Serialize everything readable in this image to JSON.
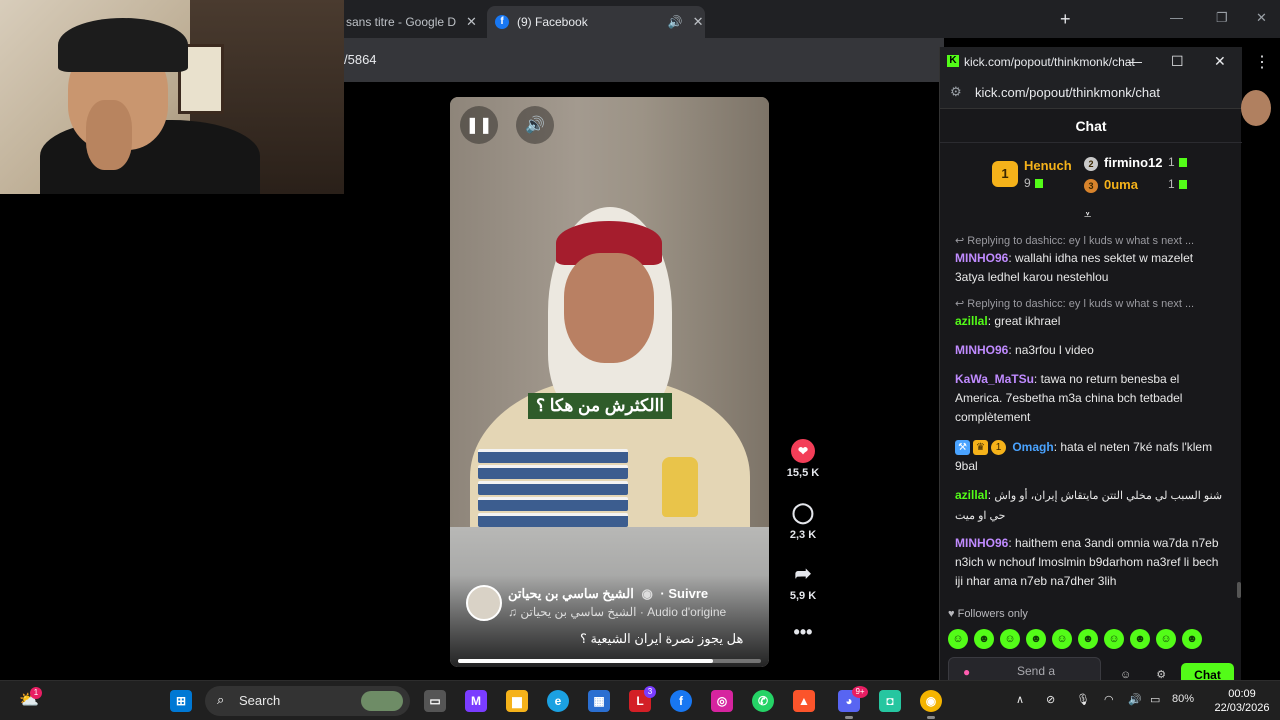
{
  "browser": {
    "tabs": [
      {
        "title": "sans titre - Google D",
        "close": "✕"
      },
      {
        "title": "(9) Facebook",
        "close": "✕"
      }
    ],
    "new_tab": "+",
    "address_fragment": "/5864",
    "menu": "⋮"
  },
  "reel": {
    "subtitle": "االكثرش من هكا ؟",
    "author": "الشيخ ساسي بن يحياتن",
    "follow": "· Suivre",
    "audio_author": "الشيخ ساسي بن يحياتن",
    "audio_label": "· Audio d'origine",
    "caption": "هل يجوز نصرة ايران الشيعية ؟",
    "progress": 0.84,
    "likes": "15,5 K",
    "comments": "2,3 K",
    "shares": "5,9 K"
  },
  "kick": {
    "window_title": "kick.com/popout/thinkmonk/chat",
    "url": "kick.com/popout/thinkmonk/chat",
    "chat_title": "Chat",
    "leaders": [
      {
        "rank": "1",
        "name": "Henuch",
        "count": "9",
        "color": "#f5b21a"
      },
      {
        "rank": "2",
        "name": "firmino12",
        "count": "1",
        "color": "#ffffff"
      },
      {
        "rank": "3",
        "name": "0uma",
        "count": "1",
        "color": "#f5b21a"
      }
    ],
    "messages": [
      {
        "reply": "Replying to dashicc: ey l kuds w what s next ...",
        "user": "MINHO96",
        "color": "#c08bff",
        "text": "wallahi idha nes sektet w mazelet 3atya ledhel karou nestehlou"
      },
      {
        "reply": "Replying to dashicc: ey l kuds w what s next ...",
        "user": "azillal",
        "color": "#53fc18",
        "text": "great ikhrael"
      },
      {
        "user": "MINHO96",
        "color": "#c08bff",
        "text": "na3rfou l video"
      },
      {
        "user": "KaWa_MaTSu",
        "color": "#c08bff",
        "text": "tawa no return benesba el America. 7esbetha m3a china bch tetbadel complètement"
      },
      {
        "user": "Omagh",
        "color": "#4aa3ff",
        "text": "hata el neten 7ké nafs l'klem 9bal"
      },
      {
        "user": "azillal",
        "color": "#53fc18",
        "text": "شنو السبب لي مخلي التتن مايتقاش إيران، أو واش حي او ميت"
      },
      {
        "user": "MINHO96",
        "color": "#c08bff",
        "text": "haithem ena 3andi omnia wa7da n7eb n3ich w nchouf lmoslmin b9darhom na3ref li bech iji nhar ama n7eb na7dher 3lih"
      }
    ],
    "followers_only": "Followers only",
    "send_placeholder": "Send a",
    "chat_button": "Chat"
  },
  "taskbar": {
    "search": "Search",
    "notif_counts": {
      "weather": "1",
      "office": "3",
      "discord": "9+"
    },
    "battery": "80%",
    "time": "00:09",
    "date": "22/03/2026"
  }
}
